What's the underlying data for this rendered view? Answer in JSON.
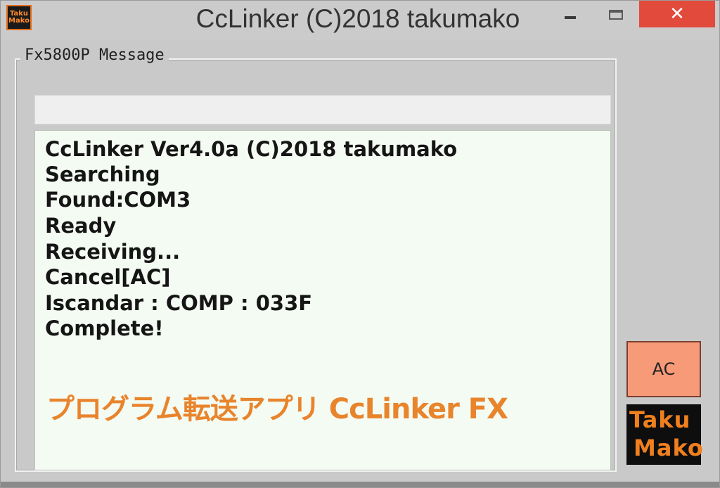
{
  "window": {
    "title": "CcLinker (C)2018 takumako",
    "icon_text": [
      "Taku",
      "Mako"
    ],
    "controls": {
      "minimize": "minimize-icon",
      "maximize": "maximize-icon",
      "close": "✕"
    }
  },
  "group": {
    "label": "Fx5800P Message",
    "status_value": ""
  },
  "log": {
    "lines": [
      "CcLinker Ver4.0a (C)2018 takumako",
      "Searching",
      "Found:COM3",
      "Ready",
      "Receiving...",
      "Cancel[AC]",
      "Iscandar : COMP : 033F",
      "Complete!"
    ],
    "caption": "プログラム転送アプリ CcLinker FX"
  },
  "side": {
    "ac_label": "AC",
    "logo_lines": [
      "Taku",
      "Mako"
    ]
  },
  "colors": {
    "close_button": "#e24a3c",
    "ac_button": "#f79a78",
    "caption_text": "#e8842c",
    "logo_text": "#f0801e",
    "message_bg": "#f4fbf2"
  }
}
